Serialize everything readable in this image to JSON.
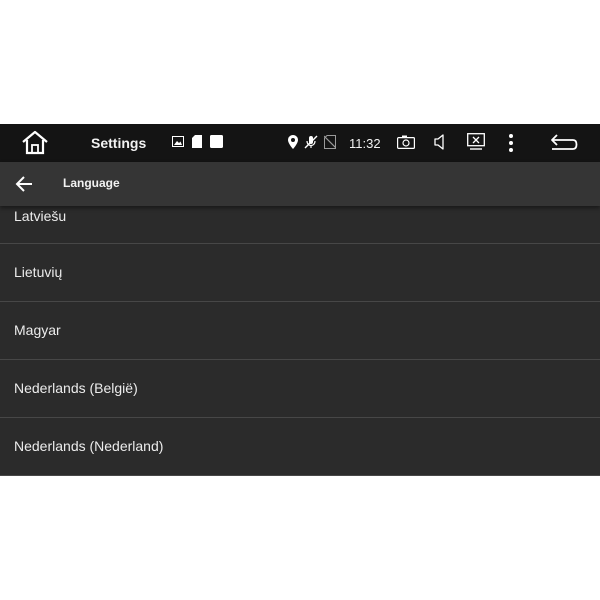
{
  "status_bar": {
    "app_title": "Settings",
    "time": "11:32",
    "icons": [
      "home-icon",
      "image-icon",
      "sd-card-icon",
      "square-icon",
      "location-icon",
      "mic-off-icon",
      "no-sim-icon",
      "camera-icon",
      "volume-icon",
      "screenshot-icon",
      "more-vert-icon",
      "back-icon"
    ]
  },
  "toolbar": {
    "title": "Language"
  },
  "languages": [
    {
      "label": "Latviešu"
    },
    {
      "label": "Lietuvių"
    },
    {
      "label": "Magyar"
    },
    {
      "label": "Nederlands (België)"
    },
    {
      "label": "Nederlands (Nederland)"
    }
  ],
  "colors": {
    "status_bar_bg": "#141414",
    "toolbar_bg": "#353535",
    "list_bg": "#2b2b2b",
    "divider": "#474747",
    "text": "#ececec"
  }
}
